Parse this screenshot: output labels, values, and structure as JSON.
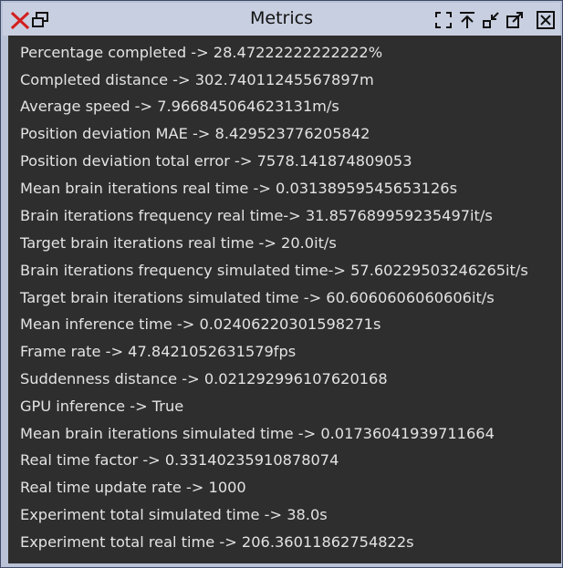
{
  "window": {
    "title": "Metrics",
    "close_icon": "close-x-icon",
    "detach_icon": "detach-window-icon",
    "fullscreen_icon": "fullscreen-icon",
    "stay_on_top_icon": "stay-on-top-icon",
    "minimize_icon": "shrink-icon",
    "maximize_icon": "expand-icon",
    "close_box_icon": "close-box-icon",
    "accent_close": "#d21f1f"
  },
  "metrics": [
    {
      "text": "Percentage completed -> 28.47222222222222%"
    },
    {
      "text": "Completed distance -> 302.74011245567897m"
    },
    {
      "text": "Average speed -> 7.966845064623131m/s"
    },
    {
      "text": "Position deviation MAE -> 8.429523776205842"
    },
    {
      "text": "Position deviation total error -> 7578.141874809053"
    },
    {
      "text": "Mean brain iterations real time -> 0.03138959545653126s"
    },
    {
      "text": "Brain iterations frequency real time-> 31.857689959235497it/s"
    },
    {
      "text": "Target brain iterations real time -> 20.0it/s"
    },
    {
      "text": "Brain iterations frequency simulated time-> 57.60229503246265it/s"
    },
    {
      "text": "Target brain iterations simulated time -> 60.6060606060606it/s"
    },
    {
      "text": "Mean inference time -> 0.02406220301598271s"
    },
    {
      "text": "Frame rate -> 47.8421052631579fps"
    },
    {
      "text": "Suddenness distance -> 0.021292996107620168"
    },
    {
      "text": "GPU inference -> True"
    },
    {
      "text": "Mean brain iterations simulated time -> 0.01736041939711664"
    },
    {
      "text": "Real time factor -> 0.33140235910878074"
    },
    {
      "text": "Real time update rate -> 1000"
    },
    {
      "text": "Experiment total simulated time -> 38.0s"
    },
    {
      "text": "Experiment total real time -> 206.36011862754822s"
    }
  ]
}
